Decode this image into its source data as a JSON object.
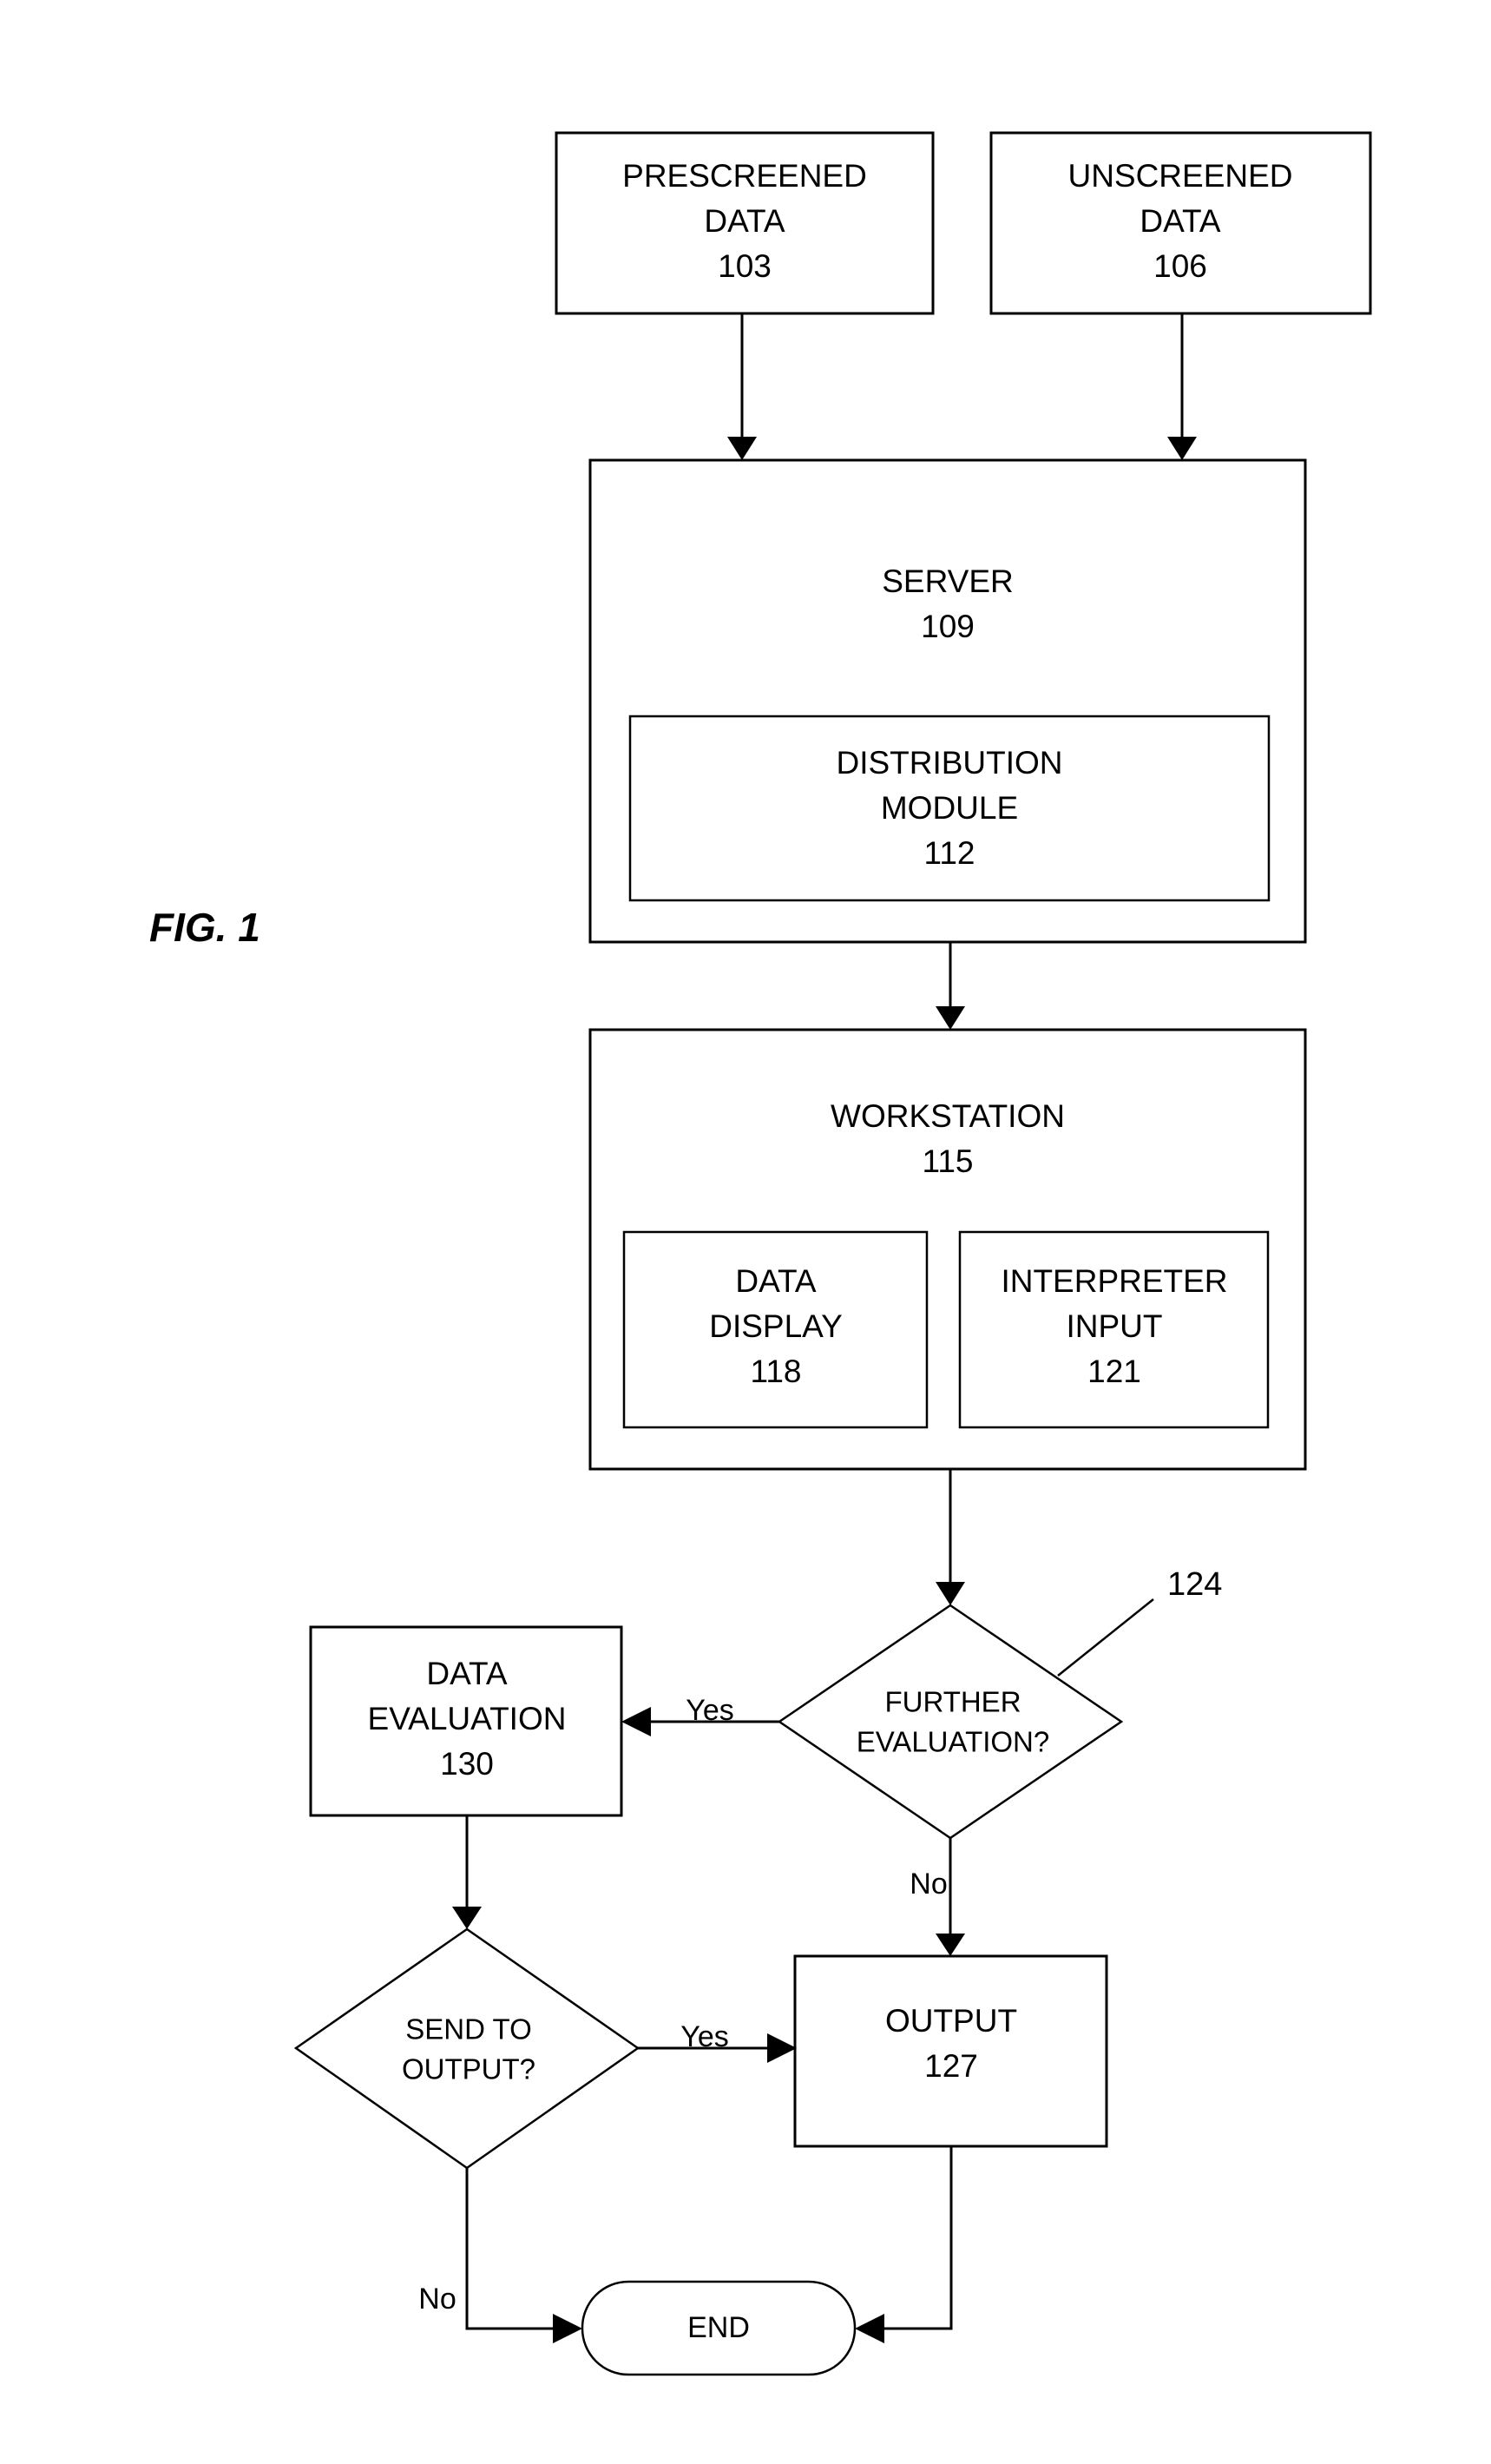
{
  "figure": {
    "caption": "FIG. 1",
    "type": "flowchart"
  },
  "nodes": {
    "prescreened_data": {
      "line1": "PRESCREENED",
      "line2": "DATA",
      "ref": "103",
      "shape": "rectangle"
    },
    "unscreened_data": {
      "line1": "UNSCREENED",
      "line2": "DATA",
      "ref": "106",
      "shape": "rectangle"
    },
    "server": {
      "line1": "SERVER",
      "ref": "109",
      "shape": "rectangle"
    },
    "distribution_module": {
      "line1": "DISTRIBUTION",
      "line2": "MODULE",
      "ref": "112",
      "shape": "rectangle"
    },
    "workstation": {
      "line1": "WORKSTATION",
      "ref": "115",
      "shape": "rectangle"
    },
    "data_display": {
      "line1": "DATA",
      "line2": "DISPLAY",
      "ref": "118",
      "shape": "rectangle"
    },
    "interpreter_input": {
      "line1": "INTERPRETER",
      "line2": "INPUT",
      "ref": "121",
      "shape": "rectangle"
    },
    "further_evaluation": {
      "line1": "FURTHER",
      "line2": "EVALUATION?",
      "ref": "124",
      "shape": "diamond"
    },
    "data_evaluation": {
      "line1": "DATA",
      "line2": "EVALUATION",
      "ref": "130",
      "shape": "rectangle"
    },
    "send_to_output": {
      "line1": "SEND TO",
      "line2": "OUTPUT?",
      "shape": "diamond"
    },
    "output": {
      "line1": "OUTPUT",
      "ref": "127",
      "shape": "rectangle"
    },
    "end": {
      "line1": "END",
      "shape": "stadium"
    }
  },
  "edge_labels": {
    "further_eval_yes": "Yes",
    "further_eval_no": "No",
    "send_output_yes": "Yes",
    "send_output_no": "No"
  },
  "colors": {
    "stroke": "#000000",
    "fill": "#ffffff",
    "text": "#000000"
  }
}
